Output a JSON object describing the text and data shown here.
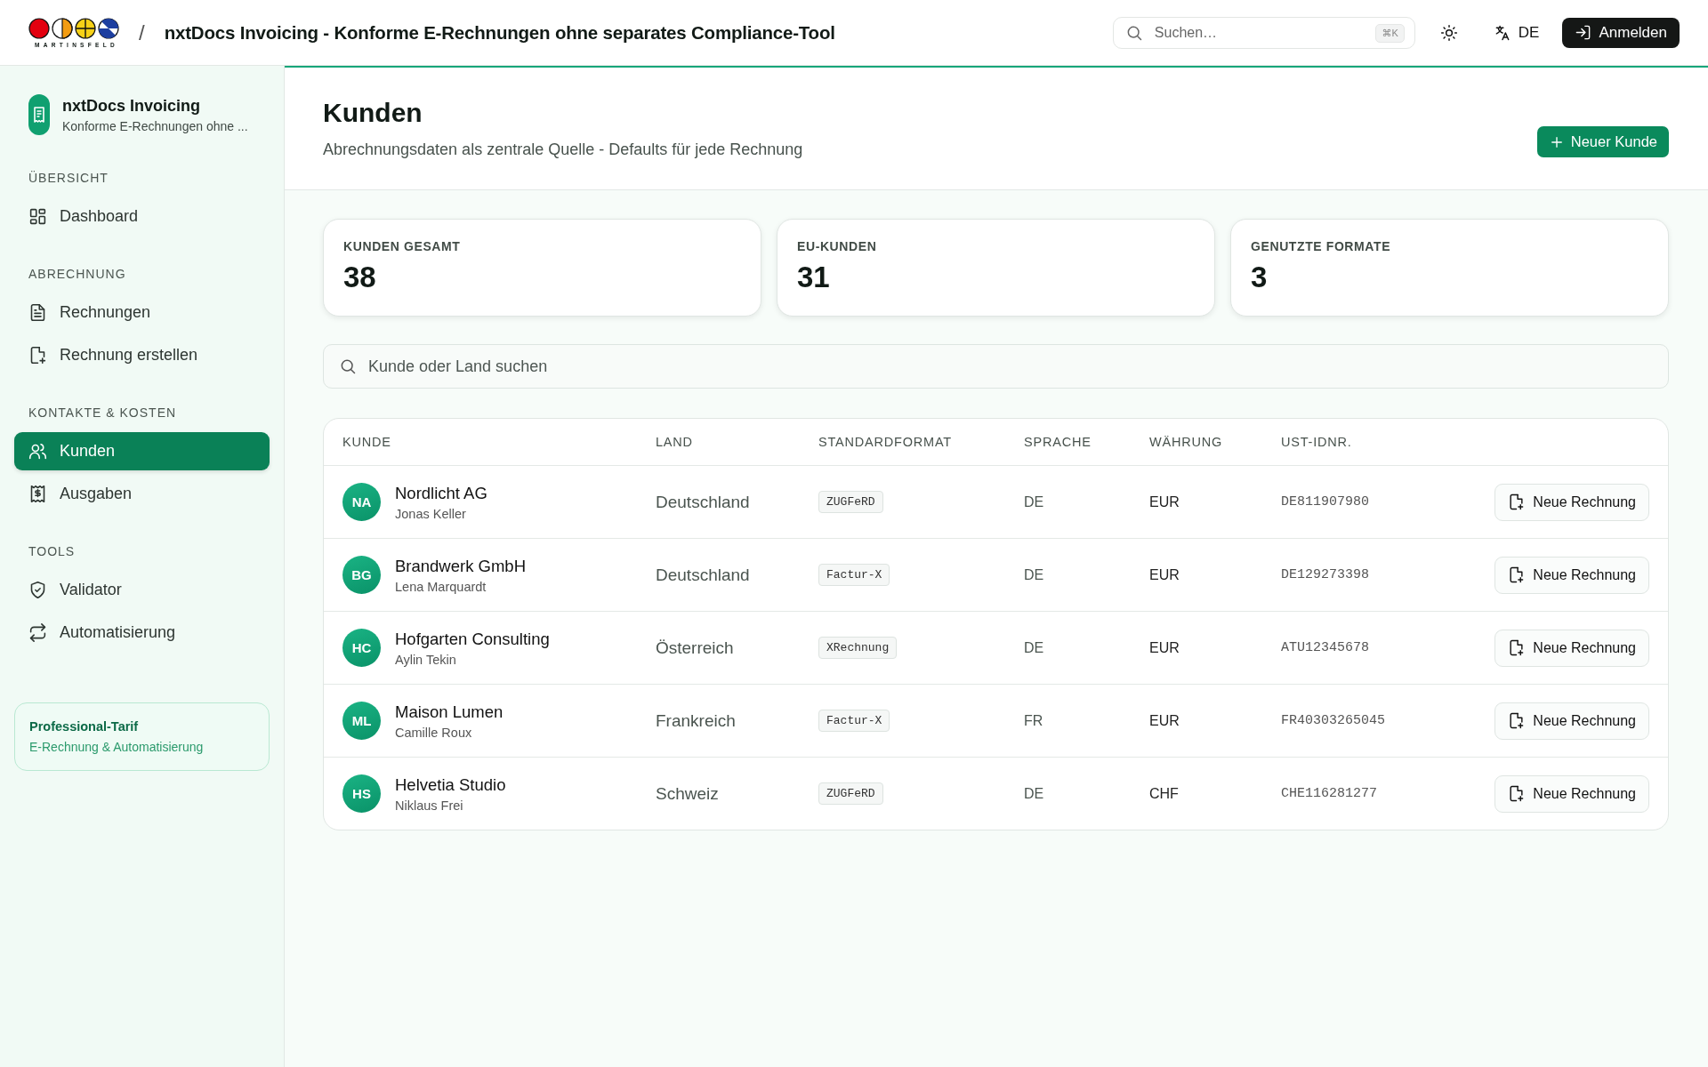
{
  "topbar": {
    "logo_text": "MARTINSFELD",
    "separator": "/",
    "title": "nxtDocs Invoicing - Konforme E-Rechnungen ohne separates Compliance-Tool",
    "search": {
      "placeholder": "Suchen…",
      "shortcut": "⌘K"
    },
    "language": "DE",
    "login_button": "Anmelden"
  },
  "sidebar": {
    "app_name": "nxtDocs Invoicing",
    "app_subtitle": "Konforme E-Rechnungen ohne ...",
    "sections": [
      {
        "title": "ÜBERSICHT",
        "items": [
          {
            "label": "Dashboard",
            "selected": false
          }
        ]
      },
      {
        "title": "ABRECHNUNG",
        "items": [
          {
            "label": "Rechnungen",
            "selected": false
          },
          {
            "label": "Rechnung erstellen",
            "selected": false
          }
        ]
      },
      {
        "title": "KONTAKTE & KOSTEN",
        "items": [
          {
            "label": "Kunden",
            "selected": true
          },
          {
            "label": "Ausgaben",
            "selected": false
          }
        ]
      },
      {
        "title": "TOOLS",
        "items": [
          {
            "label": "Validator",
            "selected": false
          },
          {
            "label": "Automatisierung",
            "selected": false
          }
        ]
      }
    ],
    "plan": {
      "title": "Professional-Tarif",
      "subtitle": "E-Rechnung & Automatisierung"
    }
  },
  "page": {
    "title": "Kunden",
    "subtitle": "Abrechnungsdaten als zentrale Quelle - Defaults für jede Rechnung",
    "new_button": "Neuer Kunde"
  },
  "stats": [
    {
      "label": "KUNDEN GESAMT",
      "value": "38"
    },
    {
      "label": "EU-KUNDEN",
      "value": "31"
    },
    {
      "label": "GENUTZTE FORMATE",
      "value": "3"
    }
  ],
  "filter": {
    "placeholder": "Kunde oder Land suchen"
  },
  "table": {
    "columns": [
      "KUNDE",
      "LAND",
      "STANDARDFORMAT",
      "SPRACHE",
      "WÄHRUNG",
      "UST-IDNR."
    ],
    "rows": [
      {
        "initials": "NA",
        "name": "Nordlicht AG",
        "contact": "Jonas Keller",
        "country": "Deutschland",
        "format": "ZUGFeRD",
        "language": "DE",
        "currency": "EUR",
        "vat_id": "DE811907980",
        "action": "Neue Rechnung"
      },
      {
        "initials": "BG",
        "name": "Brandwerk GmbH",
        "contact": "Lena Marquardt",
        "country": "Deutschland",
        "format": "Factur-X",
        "language": "DE",
        "currency": "EUR",
        "vat_id": "DE129273398",
        "action": "Neue Rechnung"
      },
      {
        "initials": "HC",
        "name": "Hofgarten Consulting",
        "contact": "Aylin Tekin",
        "country": "Österreich",
        "format": "XRechnung",
        "language": "DE",
        "currency": "EUR",
        "vat_id": "ATU12345678",
        "action": "Neue Rechnung"
      },
      {
        "initials": "ML",
        "name": "Maison Lumen",
        "contact": "Camille Roux",
        "country": "Frankreich",
        "format": "Factur-X",
        "language": "FR",
        "currency": "EUR",
        "vat_id": "FR40303265045",
        "action": "Neue Rechnung"
      },
      {
        "initials": "HS",
        "name": "Helvetia Studio",
        "contact": "Niklaus Frei",
        "country": "Schweiz",
        "format": "ZUGFeRD",
        "language": "DE",
        "currency": "CHF",
        "vat_id": "CHE116281277",
        "action": "Neue Rechnung"
      }
    ]
  }
}
